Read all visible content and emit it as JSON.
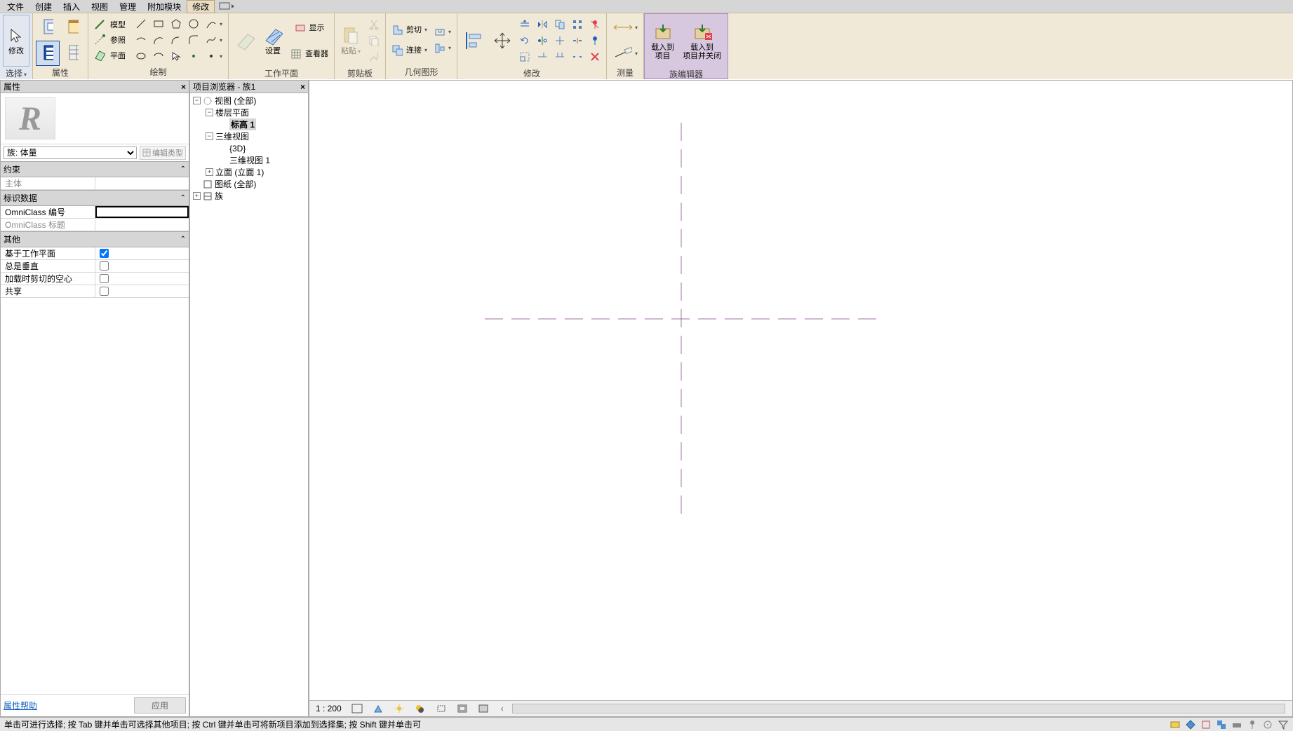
{
  "menu": {
    "items": [
      "文件",
      "创建",
      "插入",
      "视图",
      "管理",
      "附加模块",
      "修改"
    ],
    "active_index": 6
  },
  "ribbon": {
    "select": {
      "modify": "修改",
      "select": "选择"
    },
    "properties_panel": {
      "label": "属性"
    },
    "draw": {
      "model": "模型",
      "ref": "参照",
      "plane": "平面",
      "label": "绘制"
    },
    "workplane": {
      "set": "设置",
      "show": "显示",
      "viewer": "查看器",
      "label": "工作平面"
    },
    "clipboard": {
      "paste": "粘贴",
      "label": "剪贴板"
    },
    "geometry": {
      "cut": "剪切",
      "join": "连接",
      "label": "几何图形"
    },
    "modify": {
      "label": "修改"
    },
    "measure": {
      "label": "测量"
    },
    "fameditor": {
      "load_proj": "载入到\n项目",
      "load_close": "载入到\n项目并关闭",
      "label": "族编辑器"
    }
  },
  "properties": {
    "title": "属性",
    "type_selector": "族: 体量",
    "edit_type": "编辑类型",
    "groups": {
      "constraints": {
        "label": "约束",
        "host": {
          "name": "主体",
          "val": ""
        }
      },
      "identity": {
        "label": "标识数据",
        "omni_num": {
          "name": "OmniClass 编号",
          "val": ""
        },
        "omni_title": {
          "name": "OmniClass 标题",
          "val": ""
        }
      },
      "other": {
        "label": "其他",
        "workplane_based": {
          "name": "基于工作平面",
          "checked": true
        },
        "always_vert": {
          "name": "总是垂直",
          "checked": false
        },
        "cut_voids": {
          "name": "加载时剪切的空心",
          "checked": false
        },
        "shared": {
          "name": "共享",
          "checked": false
        }
      }
    },
    "help": "属性帮助",
    "apply": "应用"
  },
  "browser": {
    "title": "项目浏览器 - 族1",
    "views_all": "视图 (全部)",
    "floor_plans": "楼层平面",
    "level1": "标高 1",
    "three_d_views": "三维视图",
    "three_d": "{3D}",
    "three_d_view1": "三维视图 1",
    "elevations": "立面 (立面 1)",
    "sheets": "图纸 (全部)",
    "families": "族"
  },
  "viewbar": {
    "scale": "1 : 200"
  },
  "status": {
    "hint": "单击可进行选择; 按 Tab 键并单击可选择其他项目; 按 Ctrl 键并单击可将新项目添加到选择集; 按 Shift 键并单击可"
  }
}
